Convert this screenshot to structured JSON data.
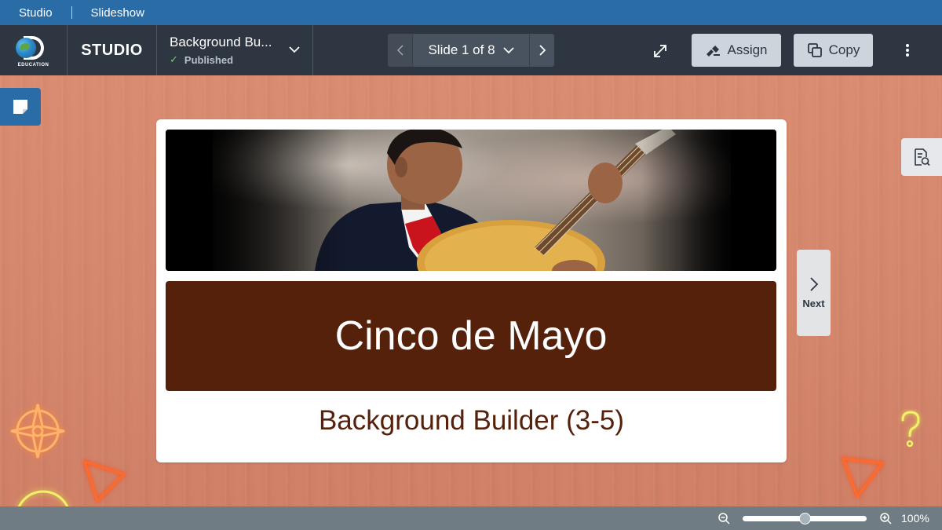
{
  "topbar": {
    "crumbs": [
      "Studio",
      "Slideshow"
    ]
  },
  "header": {
    "logo_text": "EDUCATION",
    "app_name": "STUDIO",
    "document": {
      "title": "Background Bu...",
      "status": "Published"
    },
    "slide_nav": {
      "label": "Slide 1 of 8"
    },
    "assign_label": "Assign",
    "copy_label": "Copy"
  },
  "slide": {
    "title": "Cinco de Mayo",
    "subtitle": "Background Builder (3-5)"
  },
  "next_label": "Next",
  "footer": {
    "zoom_label": "100%",
    "zoom_fraction": 0.5
  },
  "colors": {
    "top_bar": "#2a6ca6",
    "header": "#2d3641",
    "title_band": "#55210b",
    "background": "#d3866e"
  },
  "icons": {
    "notes": "sticky-note-icon",
    "resources": "document-search-icon",
    "expand": "expand-icon",
    "assign": "assign-icon",
    "copy": "copy-icon",
    "more": "kebab-icon"
  }
}
